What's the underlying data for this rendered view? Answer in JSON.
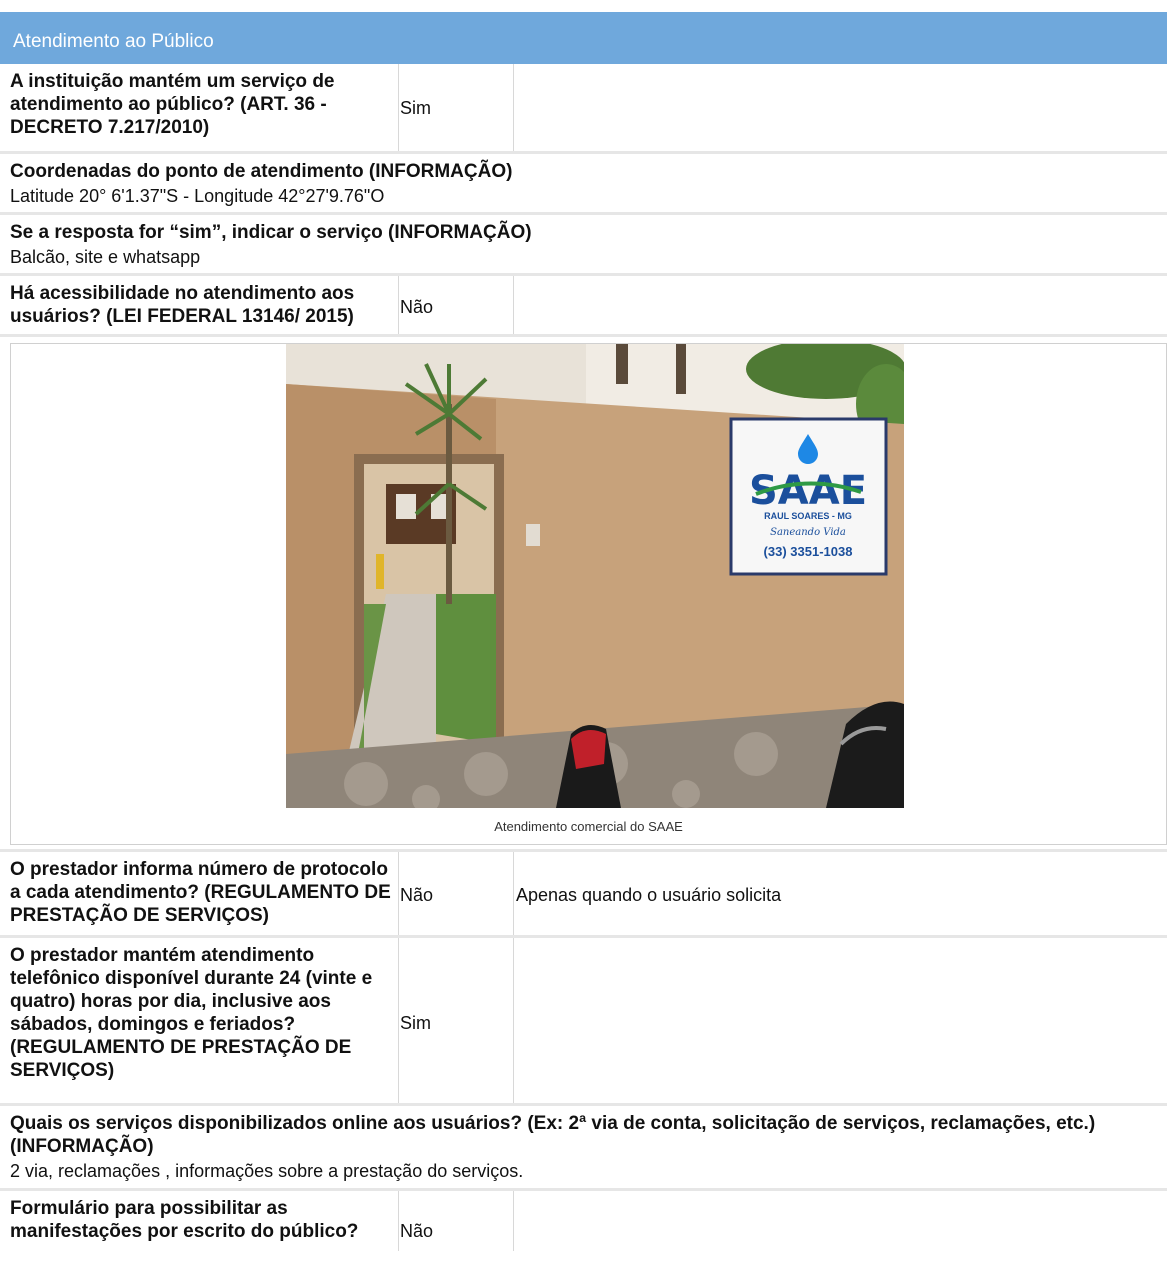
{
  "section": {
    "title": "Atendimento ao Público"
  },
  "rows": [
    {
      "question": "A instituição mantém um serviço de atendimento ao público? (ART. 36 - DECRETO 7.217/2010)",
      "answer": "Sim",
      "note": ""
    },
    {
      "question": "Coordenadas do ponto de atendimento (INFORMAÇÃO)",
      "answer": "Latitude 20°  6'1.37\"S - Longitude 42°27'9.76\"O"
    },
    {
      "question": "Se a resposta for “sim”, indicar o serviço (INFORMAÇÃO)",
      "answer": "Balcão, site e whatsapp"
    },
    {
      "question": "Há acessibilidade no atendimento aos usuários? (LEI FEDERAL 13146/ 2015)",
      "answer": "Não",
      "note": ""
    },
    {
      "question": "O prestador informa número de protocolo a cada atendimento? (REGULAMENTO DE PRESTAÇÃO DE SERVIÇOS)",
      "answer": "Não",
      "note": "Apenas quando o usuário solicita"
    },
    {
      "question": "O prestador mantém atendimento telefônico disponível durante 24 (vinte e quatro) horas por dia, inclusive aos sábados, domingos e feriados? (REGULAMENTO DE PRESTAÇÃO DE SERVIÇOS)",
      "answer": "Sim",
      "note": ""
    },
    {
      "question": "Quais os serviços disponibilizados online aos usuários? (Ex: 2ª via de conta, solicitação de serviços, reclamações, etc.) (INFORMAÇÃO)",
      "answer": "2 via, reclamações , informações sobre a prestação do serviços."
    },
    {
      "question": "Formulário para possibilitar as manifestações por escrito do público?",
      "answer": "Não",
      "note": ""
    }
  ],
  "photo": {
    "caption": "Atendimento comercial do SAAE",
    "sign": {
      "logo": "SAAE",
      "city": "RAUL SOARES - MG",
      "slogan": "Saneando Vida",
      "phone": "(33) 3351-1038"
    }
  }
}
